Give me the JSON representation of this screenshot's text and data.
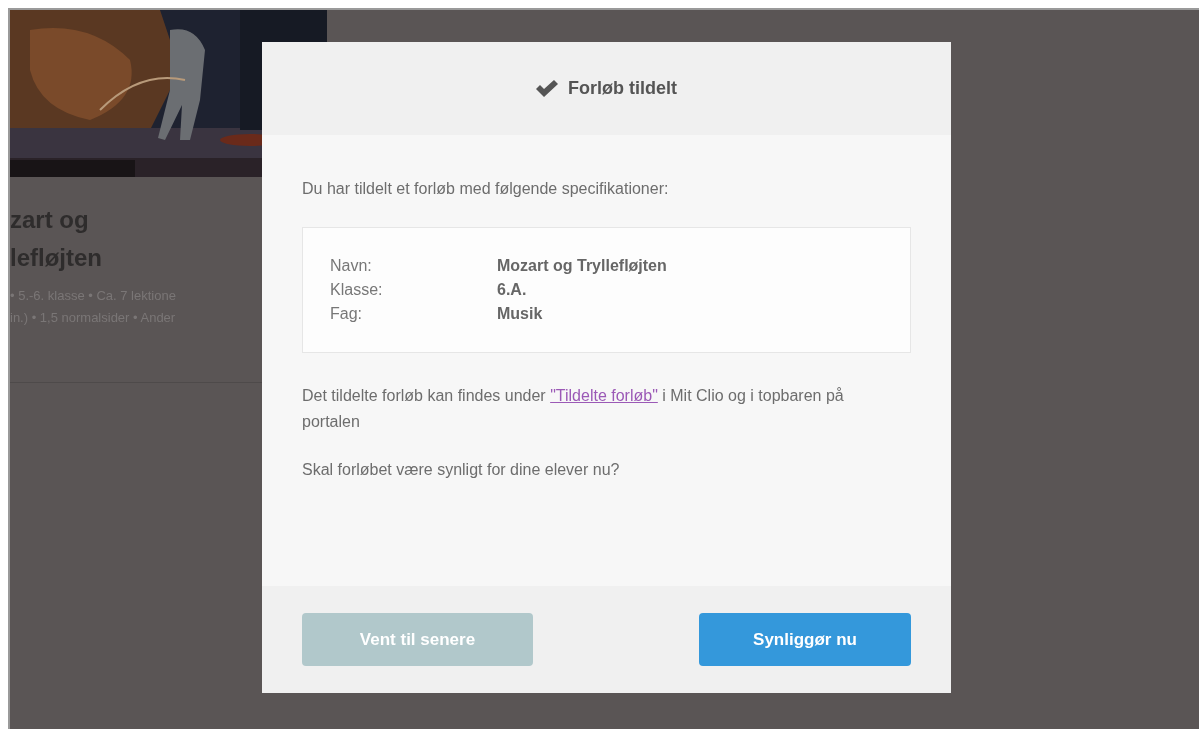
{
  "background_card": {
    "picture": {
      "kind": "picture"
    },
    "title_lines": [
      "zart og",
      "lefløjten"
    ],
    "meta_lines": [
      "• 5.-6. klasse • Ca. 7 lektione",
      "in.) • 1,5 normalsider • Ander"
    ]
  },
  "modal": {
    "title": "Forløb tildelt",
    "intro": "Du har tildelt et forløb med følgende specifikationer:",
    "details": [
      {
        "label": "Navn:",
        "value": "Mozart og Tryllefløjten"
      },
      {
        "label": "Klasse:",
        "value": "6.A."
      },
      {
        "label": "Fag:",
        "value": "Musik"
      }
    ],
    "info": {
      "before": "Det tildelte forløb kan findes under ",
      "link": "\"Tildelte forløb\"",
      "after": " i Mit Clio og i topbaren på portalen"
    },
    "question": "Skal forløbet være synligt for dine elever nu?",
    "buttons": [
      {
        "label": "Vent til senere",
        "disabled": true
      },
      {
        "label": "Synliggør nu",
        "disabled": false
      }
    ]
  }
}
